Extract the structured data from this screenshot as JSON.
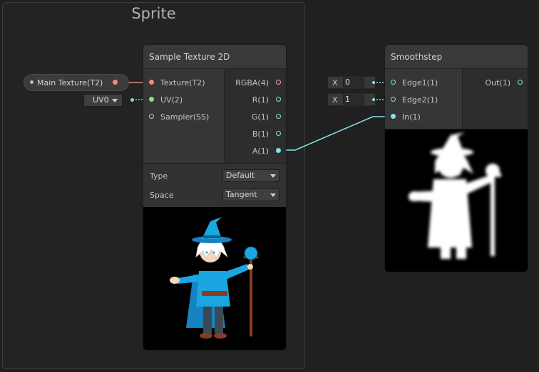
{
  "group": {
    "title": "Sprite"
  },
  "main_texture_node": {
    "label": "Main Texture(T2)"
  },
  "uv_dropdown": {
    "value": "UV0"
  },
  "sample_node": {
    "title": "Sample Texture 2D",
    "inputs": [
      "Texture(T2)",
      "UV(2)",
      "Sampler(SS)"
    ],
    "outputs": [
      "RGBA(4)",
      "R(1)",
      "G(1)",
      "B(1)",
      "A(1)"
    ],
    "type_label": "Type",
    "type_value": "Default",
    "space_label": "Space",
    "space_value": "Tangent"
  },
  "edge1_field": {
    "axis": "X",
    "value": "0"
  },
  "edge2_field": {
    "axis": "X",
    "value": "1"
  },
  "smoothstep_node": {
    "title": "Smoothstep",
    "inputs": [
      "Edge1(1)",
      "Edge2(1)",
      "In(1)"
    ],
    "outputs": [
      "Out(1)"
    ]
  },
  "colors": {
    "texture_port": "#f08a8a",
    "vector2_port": "#8fdc8f",
    "float_port": "#84e4e7",
    "wizard_blue": "#1aa6e0"
  }
}
